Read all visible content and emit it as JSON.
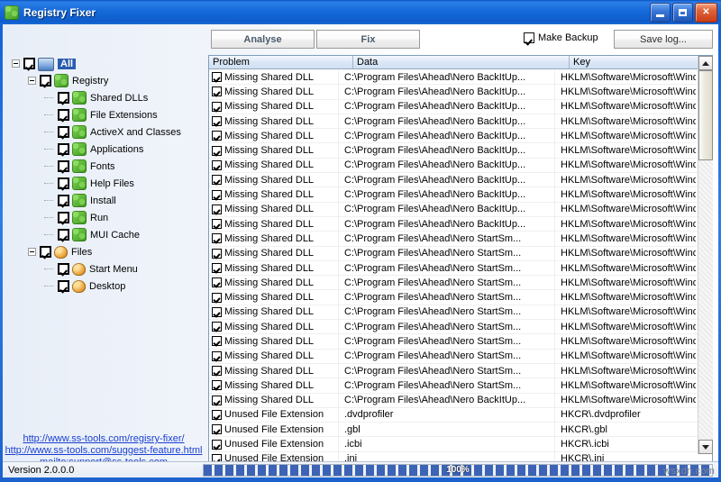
{
  "window": {
    "title": "Registry Fixer",
    "icon": "registry-puzzle-icon",
    "minimize_label": "Minimize",
    "maximize_label": "Maximize",
    "close_label": "✕"
  },
  "toolbar": {
    "analyse_label": "Analyse",
    "fix_label": "Fix",
    "make_backup_label": "Make Backup",
    "make_backup_checked": true,
    "save_log_label": "Save log..."
  },
  "tree": {
    "nodes": [
      {
        "label": "All",
        "icon": "monitor-icon",
        "depth": 0,
        "checked": true,
        "selected": true,
        "expander": "collapse"
      },
      {
        "label": "Registry",
        "icon": "registry-icon",
        "depth": 1,
        "checked": true,
        "selected": false,
        "expander": "collapse"
      },
      {
        "label": "Shared DLLs",
        "icon": "registry-icon",
        "depth": 2,
        "checked": true,
        "selected": false,
        "expander": "none"
      },
      {
        "label": "File Extensions",
        "icon": "registry-icon",
        "depth": 2,
        "checked": true,
        "selected": false,
        "expander": "none"
      },
      {
        "label": "ActiveX and Classes",
        "icon": "registry-icon",
        "depth": 2,
        "checked": true,
        "selected": false,
        "expander": "none"
      },
      {
        "label": "Applications",
        "icon": "registry-icon",
        "depth": 2,
        "checked": true,
        "selected": false,
        "expander": "none"
      },
      {
        "label": "Fonts",
        "icon": "registry-icon",
        "depth": 2,
        "checked": true,
        "selected": false,
        "expander": "none"
      },
      {
        "label": "Help Files",
        "icon": "registry-icon",
        "depth": 2,
        "checked": true,
        "selected": false,
        "expander": "none"
      },
      {
        "label": "Install",
        "icon": "registry-icon",
        "depth": 2,
        "checked": true,
        "selected": false,
        "expander": "none"
      },
      {
        "label": "Run",
        "icon": "registry-icon",
        "depth": 2,
        "checked": true,
        "selected": false,
        "expander": "none"
      },
      {
        "label": "MUI Cache",
        "icon": "registry-icon",
        "depth": 2,
        "checked": true,
        "selected": false,
        "expander": "none"
      },
      {
        "label": "Files",
        "icon": "files-icon",
        "depth": 1,
        "checked": true,
        "selected": false,
        "expander": "collapse"
      },
      {
        "label": "Start Menu",
        "icon": "files-icon",
        "depth": 2,
        "checked": true,
        "selected": false,
        "expander": "none"
      },
      {
        "label": "Desktop",
        "icon": "files-icon",
        "depth": 2,
        "checked": true,
        "selected": false,
        "expander": "none"
      }
    ]
  },
  "links": [
    {
      "text": "http://www.ss-tools.com/regisry-fixer/"
    },
    {
      "text": "http://www.ss-tools.com/suggest-feature.html"
    },
    {
      "text": "mailto:support@ss-tools.com"
    }
  ],
  "list": {
    "columns": [
      "Problem",
      "Data",
      "Key"
    ],
    "rows": [
      {
        "checked": true,
        "problem": "Missing Shared DLL",
        "data": "C:\\Program Files\\Ahead\\Nero BackItUp...",
        "key": "HKLM\\Software\\Microsoft\\Windows\\Cu"
      },
      {
        "checked": true,
        "problem": "Missing Shared DLL",
        "data": "C:\\Program Files\\Ahead\\Nero BackItUp...",
        "key": "HKLM\\Software\\Microsoft\\Windows\\Cu"
      },
      {
        "checked": true,
        "problem": "Missing Shared DLL",
        "data": "C:\\Program Files\\Ahead\\Nero BackItUp...",
        "key": "HKLM\\Software\\Microsoft\\Windows\\Cu"
      },
      {
        "checked": true,
        "problem": "Missing Shared DLL",
        "data": "C:\\Program Files\\Ahead\\Nero BackItUp...",
        "key": "HKLM\\Software\\Microsoft\\Windows\\Cu"
      },
      {
        "checked": true,
        "problem": "Missing Shared DLL",
        "data": "C:\\Program Files\\Ahead\\Nero BackItUp...",
        "key": "HKLM\\Software\\Microsoft\\Windows\\Cu"
      },
      {
        "checked": true,
        "problem": "Missing Shared DLL",
        "data": "C:\\Program Files\\Ahead\\Nero BackItUp...",
        "key": "HKLM\\Software\\Microsoft\\Windows\\Cu"
      },
      {
        "checked": true,
        "problem": "Missing Shared DLL",
        "data": "C:\\Program Files\\Ahead\\Nero BackItUp...",
        "key": "HKLM\\Software\\Microsoft\\Windows\\Cu"
      },
      {
        "checked": true,
        "problem": "Missing Shared DLL",
        "data": "C:\\Program Files\\Ahead\\Nero BackItUp...",
        "key": "HKLM\\Software\\Microsoft\\Windows\\Cu"
      },
      {
        "checked": true,
        "problem": "Missing Shared DLL",
        "data": "C:\\Program Files\\Ahead\\Nero BackItUp...",
        "key": "HKLM\\Software\\Microsoft\\Windows\\Cu"
      },
      {
        "checked": true,
        "problem": "Missing Shared DLL",
        "data": "C:\\Program Files\\Ahead\\Nero BackItUp...",
        "key": "HKLM\\Software\\Microsoft\\Windows\\Cu"
      },
      {
        "checked": true,
        "problem": "Missing Shared DLL",
        "data": "C:\\Program Files\\Ahead\\Nero BackItUp...",
        "key": "HKLM\\Software\\Microsoft\\Windows\\Cu"
      },
      {
        "checked": true,
        "problem": "Missing Shared DLL",
        "data": "C:\\Program Files\\Ahead\\Nero StartSm...",
        "key": "HKLM\\Software\\Microsoft\\Windows\\Cu"
      },
      {
        "checked": true,
        "problem": "Missing Shared DLL",
        "data": "C:\\Program Files\\Ahead\\Nero StartSm...",
        "key": "HKLM\\Software\\Microsoft\\Windows\\Cu"
      },
      {
        "checked": true,
        "problem": "Missing Shared DLL",
        "data": "C:\\Program Files\\Ahead\\Nero StartSm...",
        "key": "HKLM\\Software\\Microsoft\\Windows\\Cu"
      },
      {
        "checked": true,
        "problem": "Missing Shared DLL",
        "data": "C:\\Program Files\\Ahead\\Nero StartSm...",
        "key": "HKLM\\Software\\Microsoft\\Windows\\Cu"
      },
      {
        "checked": true,
        "problem": "Missing Shared DLL",
        "data": "C:\\Program Files\\Ahead\\Nero StartSm...",
        "key": "HKLM\\Software\\Microsoft\\Windows\\Cu"
      },
      {
        "checked": true,
        "problem": "Missing Shared DLL",
        "data": "C:\\Program Files\\Ahead\\Nero StartSm...",
        "key": "HKLM\\Software\\Microsoft\\Windows\\Cu"
      },
      {
        "checked": true,
        "problem": "Missing Shared DLL",
        "data": "C:\\Program Files\\Ahead\\Nero StartSm...",
        "key": "HKLM\\Software\\Microsoft\\Windows\\Cu"
      },
      {
        "checked": true,
        "problem": "Missing Shared DLL",
        "data": "C:\\Program Files\\Ahead\\Nero StartSm...",
        "key": "HKLM\\Software\\Microsoft\\Windows\\Cu"
      },
      {
        "checked": true,
        "problem": "Missing Shared DLL",
        "data": "C:\\Program Files\\Ahead\\Nero StartSm...",
        "key": "HKLM\\Software\\Microsoft\\Windows\\Cu"
      },
      {
        "checked": true,
        "problem": "Missing Shared DLL",
        "data": "C:\\Program Files\\Ahead\\Nero StartSm...",
        "key": "HKLM\\Software\\Microsoft\\Windows\\Cu"
      },
      {
        "checked": true,
        "problem": "Missing Shared DLL",
        "data": "C:\\Program Files\\Ahead\\Nero StartSm...",
        "key": "HKLM\\Software\\Microsoft\\Windows\\Cu"
      },
      {
        "checked": true,
        "problem": "Missing Shared DLL",
        "data": "C:\\Program Files\\Ahead\\Nero BackItUp...",
        "key": "HKLM\\Software\\Microsoft\\Windows\\Cu"
      },
      {
        "checked": true,
        "problem": "Unused File Extension",
        "data": ".dvdprofiler",
        "key": "HKCR\\.dvdprofiler"
      },
      {
        "checked": true,
        "problem": "Unused File Extension",
        "data": ".gbl",
        "key": "HKCR\\.gbl"
      },
      {
        "checked": true,
        "problem": "Unused File Extension",
        "data": ".icbi",
        "key": "HKCR\\.icbi"
      },
      {
        "checked": true,
        "problem": "Unused File Extension",
        "data": ".ini",
        "key": "HKCR\\.ini"
      }
    ]
  },
  "statusbar": {
    "version": "Version 2.0.0.0",
    "progress_text": "100%",
    "progress_percent": 100,
    "watermark": "wsxdn.com"
  }
}
